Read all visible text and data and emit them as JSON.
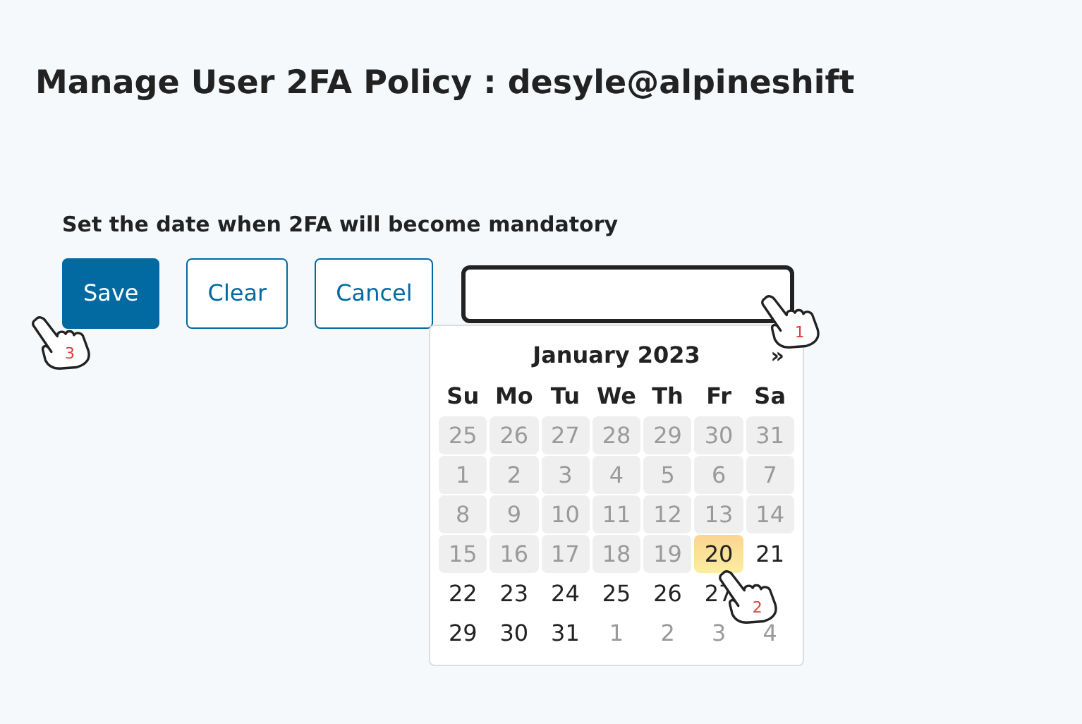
{
  "page_title": "Manage User 2FA Policy : desyle@alpineshift",
  "form": {
    "label": "Set the date when 2FA will become mandatory",
    "buttons": [
      {
        "label": "Save",
        "kind": "primary",
        "annotation_step": "3"
      },
      {
        "label": "Clear",
        "kind": "outline"
      },
      {
        "label": "Cancel",
        "kind": "outline"
      }
    ],
    "date_field": {
      "focused": true,
      "annotation_step": "1"
    }
  },
  "calendar": {
    "month_title": "January 2023",
    "next_button": "»",
    "weekdays": [
      "Su",
      "Mo",
      "Tu",
      "We",
      "Th",
      "Fr",
      "Sa"
    ],
    "weeks": [
      [
        {
          "day": "25",
          "kind": "disabled"
        },
        {
          "day": "26",
          "kind": "disabled"
        },
        {
          "day": "27",
          "kind": "disabled"
        },
        {
          "day": "28",
          "kind": "disabled"
        },
        {
          "day": "29",
          "kind": "disabled"
        },
        {
          "day": "30",
          "kind": "disabled"
        },
        {
          "day": "31",
          "kind": "disabled"
        }
      ],
      [
        {
          "day": "1",
          "kind": "disabled"
        },
        {
          "day": "2",
          "kind": "disabled"
        },
        {
          "day": "3",
          "kind": "disabled"
        },
        {
          "day": "4",
          "kind": "disabled"
        },
        {
          "day": "5",
          "kind": "disabled"
        },
        {
          "day": "6",
          "kind": "disabled"
        },
        {
          "day": "7",
          "kind": "disabled"
        }
      ],
      [
        {
          "day": "8",
          "kind": "disabled"
        },
        {
          "day": "9",
          "kind": "disabled"
        },
        {
          "day": "10",
          "kind": "disabled"
        },
        {
          "day": "11",
          "kind": "disabled"
        },
        {
          "day": "12",
          "kind": "disabled"
        },
        {
          "day": "13",
          "kind": "disabled"
        },
        {
          "day": "14",
          "kind": "disabled"
        }
      ],
      [
        {
          "day": "15",
          "kind": "disabled"
        },
        {
          "day": "16",
          "kind": "disabled"
        },
        {
          "day": "17",
          "kind": "disabled"
        },
        {
          "day": "18",
          "kind": "disabled"
        },
        {
          "day": "19",
          "kind": "disabled"
        },
        {
          "day": "20",
          "kind": "today",
          "annotation_step": "2"
        },
        {
          "day": "21",
          "kind": "normal"
        }
      ],
      [
        {
          "day": "22",
          "kind": "normal"
        },
        {
          "day": "23",
          "kind": "normal"
        },
        {
          "day": "24",
          "kind": "normal"
        },
        {
          "day": "25",
          "kind": "normal"
        },
        {
          "day": "26",
          "kind": "normal"
        },
        {
          "day": "27",
          "kind": "normal"
        },
        {
          "kind": "covered"
        }
      ],
      [
        {
          "day": "29",
          "kind": "normal"
        },
        {
          "day": "30",
          "kind": "normal"
        },
        {
          "day": "31",
          "kind": "normal"
        },
        {
          "day": "1",
          "kind": "other_month"
        },
        {
          "day": "2",
          "kind": "other_month"
        },
        {
          "day": "3",
          "kind": "other_month"
        },
        {
          "day": "4",
          "kind": "other_month"
        }
      ]
    ]
  }
}
